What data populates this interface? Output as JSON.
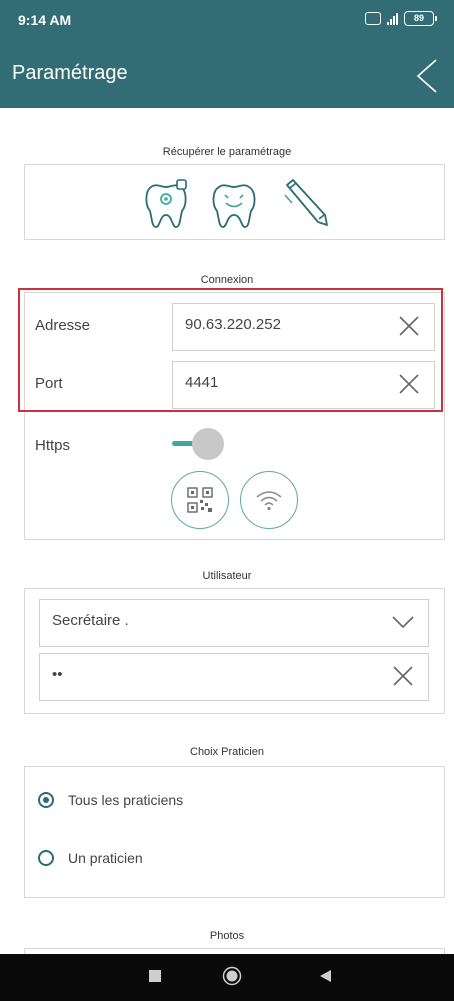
{
  "status_bar": {
    "time": "9:14 AM",
    "volte": "VoLTE",
    "network": "4G",
    "battery": "89"
  },
  "header": {
    "title": "Paramétrage"
  },
  "sections": {
    "recuperer": {
      "title": "Récupérer le paramétrage"
    },
    "connexion": {
      "title": "Connexion",
      "address_label": "Adresse",
      "address_value": "90.63.220.252",
      "port_label": "Port",
      "port_value": "4441",
      "https_label": "Https",
      "https_enabled": true
    },
    "utilisateur": {
      "title": "Utilisateur",
      "user_selected": "Secrétaire .",
      "password_masked": "••"
    },
    "praticien": {
      "title": "Choix Praticien",
      "options": [
        {
          "label": "Tous les praticiens",
          "checked": true
        },
        {
          "label": "Un praticien",
          "checked": false
        }
      ]
    },
    "photos": {
      "title": "Photos"
    }
  },
  "colors": {
    "primary": "#326d76",
    "accent": "#3fa99d",
    "highlight": "#c8323a"
  },
  "icons": [
    "tooth-scan-icon",
    "tooth-smile-icon",
    "pen-icon",
    "qr-code-icon",
    "wifi-icon",
    "close-icon",
    "chevron-down-icon",
    "back-chevron-icon"
  ]
}
